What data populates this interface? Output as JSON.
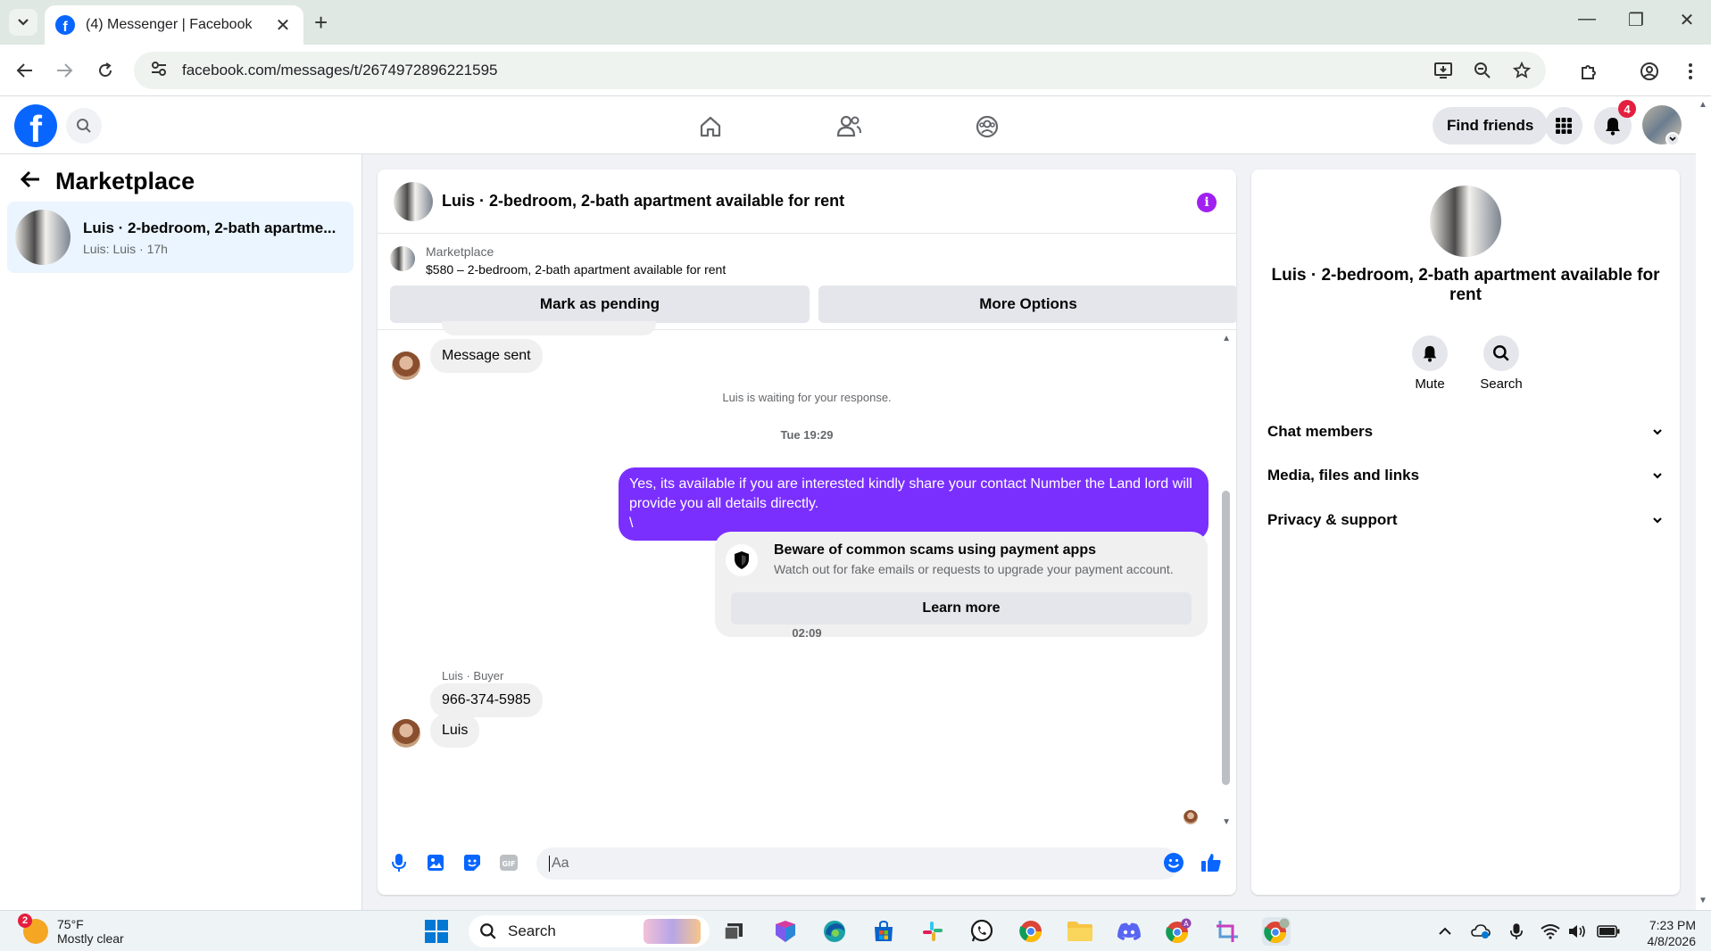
{
  "browser": {
    "tab_title": "(4) Messenger | Facebook",
    "url": "facebook.com/messages/t/2674972896221595"
  },
  "header": {
    "find_friends": "Find friends",
    "notification_count": "4"
  },
  "sidebar": {
    "title": "Marketplace",
    "conversation": {
      "name": "Luis · 2-bedroom, 2-bath apartme...",
      "preview": "Luis: Luis · 17h"
    }
  },
  "chat": {
    "title": "Luis · 2-bedroom, 2-bath apartment available for rent",
    "marketplace_label": "Marketplace",
    "listing": "$580 – 2-bedroom, 2-bath apartment available for rent",
    "mark_pending": "Mark as pending",
    "more_options": "More Options",
    "messages": {
      "message_sent": "Message sent",
      "waiting": "Luis is waiting for your response.",
      "time1": "Tue 19:29",
      "outgoing": "Yes, its available if you are interested kindly share your contact Number the Land lord will provide you all details directly.\n\\",
      "scam_title": "Beware of common scams using payment apps",
      "scam_desc": "Watch out for fake emails or requests to upgrade your payment account.",
      "learn_more": "Learn more",
      "time2": "02:09",
      "sender": "Luis · Buyer",
      "incoming1": "966-374-5985",
      "incoming2": "Luis"
    },
    "composer_placeholder": "Aa"
  },
  "info_panel": {
    "name": "Luis · 2-bedroom, 2-bath apartment available for rent",
    "mute": "Mute",
    "search": "Search",
    "rows": [
      "Chat members",
      "Media, files and links",
      "Privacy & support"
    ]
  },
  "taskbar": {
    "weather_badge": "2",
    "temp": "75°F",
    "condition": "Mostly clear",
    "search": "Search",
    "time": "7:23 PM",
    "date": "4/8/2026"
  },
  "colors": {
    "fb_blue": "#0866ff",
    "outgoing_bubble": "#7a2fff",
    "selected_conversation": "#ebf5ff"
  }
}
